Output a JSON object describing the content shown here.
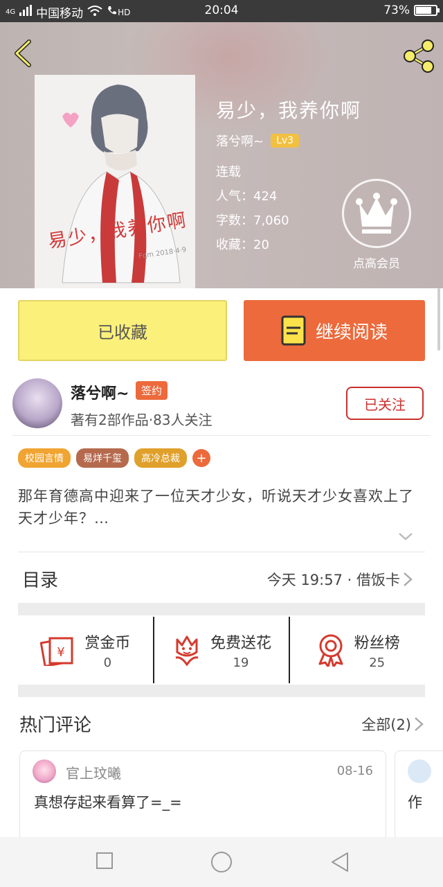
{
  "status_bar": {
    "network": "4G",
    "carrier": "中国移动",
    "hd": "HD",
    "time": "20:04",
    "battery_percent": "73%",
    "battery_level": 0.73
  },
  "book": {
    "title": "易少，我养你啊",
    "author": "落兮啊~",
    "author_level": "Lv3",
    "status": "连载",
    "popularity": "人气：424",
    "word_count": "字数：7,060",
    "favorites": "收藏：20",
    "cover_title": "易少，我养你啊",
    "vip_label": "点高会员"
  },
  "actions": {
    "favorited_label": "已收藏",
    "continue_label": "继续阅读"
  },
  "author": {
    "name": "落兮啊~",
    "badge": "签约",
    "stats": "著有2部作品·83人关注",
    "follow_label": "已关注"
  },
  "tags": [
    {
      "label": "校园言情",
      "color": "#f0a432"
    },
    {
      "label": "易烊千玺",
      "color": "#b56a4e"
    },
    {
      "label": "高冷总裁",
      "color": "#e0a02c"
    }
  ],
  "tag_add": "+",
  "description": "那年育德高中迎来了一位天才少女，听说天才少女喜欢上了天才少年？…",
  "toc": {
    "title": "目录",
    "latest": "今天 19:57 · 借饭卡"
  },
  "stats": [
    {
      "label": "赏金币",
      "value": "0",
      "icon": "red-envelope-icon"
    },
    {
      "label": "免费送花",
      "value": "19",
      "icon": "flower-icon"
    },
    {
      "label": "粉丝榜",
      "value": "25",
      "icon": "rosette-icon"
    }
  ],
  "comments": {
    "title": "热门评论",
    "all_label": "全部(2)",
    "items": [
      {
        "user": "官上玟曦",
        "date": "08-16",
        "text": "真想存起来看算了=_="
      },
      {
        "user": "",
        "date": "",
        "text": "作"
      }
    ]
  },
  "colors": {
    "accent_orange": "#ec6a3c",
    "favorite_yellow": "#fbf07a",
    "follow_red": "#c9302c"
  }
}
